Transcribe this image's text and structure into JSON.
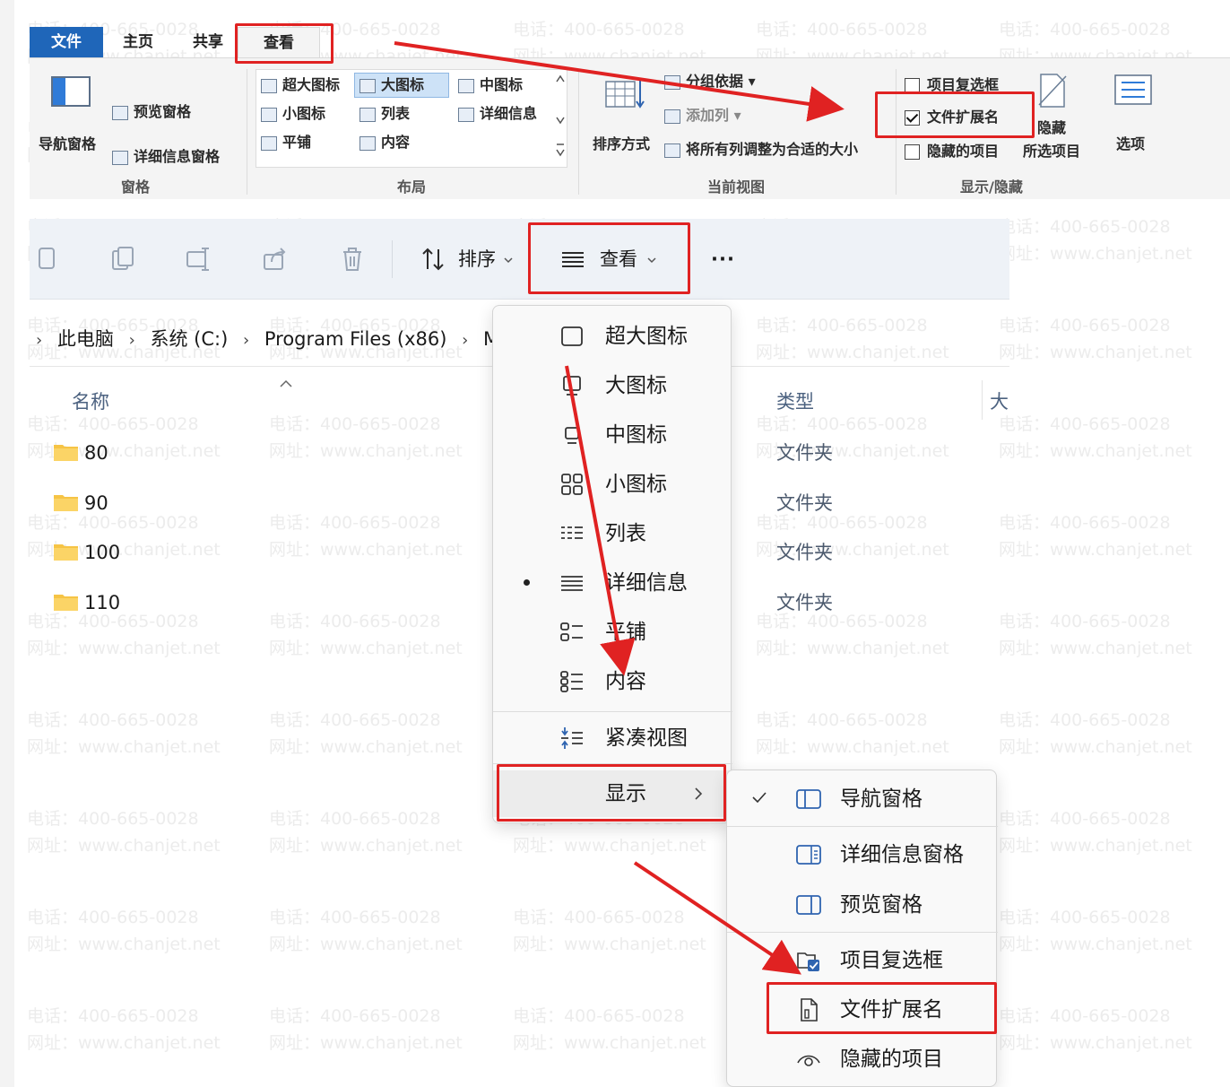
{
  "watermark": {
    "phone": "电话：400-665-0028",
    "site": "网址：www.chanjet.net"
  },
  "ribbon": {
    "tabs": {
      "file": "文件",
      "home": "主页",
      "share": "共享",
      "view": "查看"
    },
    "groups": {
      "panes": {
        "label": "窗格",
        "nav_pane": "导航窗格",
        "preview_pane": "预览窗格",
        "details_pane": "详细信息窗格"
      },
      "layout": {
        "label": "布局",
        "extra_large": "超大图标",
        "large": "大图标",
        "medium": "中图标",
        "small": "小图标",
        "list": "列表",
        "details": "详细信息",
        "tiles": "平铺",
        "content": "内容"
      },
      "current_view": {
        "label": "当前视图",
        "sort_by": "排序方式",
        "group_by": "分组依据",
        "add_column": "添加列",
        "fit_columns": "将所有列调整为合适的大小"
      },
      "show_hide": {
        "label": "显示/隐藏",
        "item_checkboxes": "项目复选框",
        "file_ext": "文件扩展名",
        "hidden_items": "隐藏的项目",
        "hide_selected": "隐藏",
        "selected_items": "所选项目",
        "options": "选项",
        "file_ext_checked": true
      }
    }
  },
  "cmdbar": {
    "sort_label": "排序",
    "view_label": "查看",
    "more": "···"
  },
  "breadcrumb": [
    "此电脑",
    "系统 (C:)",
    "Program Files (x86)",
    "Mic"
  ],
  "columns": {
    "name": "名称",
    "type": "类型",
    "size": "大"
  },
  "files": [
    {
      "name": "80",
      "type": "文件夹"
    },
    {
      "name": "90",
      "type": "文件夹"
    },
    {
      "name": "100",
      "type": "文件夹"
    },
    {
      "name": "110",
      "type": "文件夹"
    }
  ],
  "view_menu": {
    "items": [
      "超大图标",
      "大图标",
      "中图标",
      "小图标",
      "列表",
      "详细信息",
      "平铺",
      "内容"
    ],
    "selected_index": 5,
    "compact": "紧凑视图",
    "show": "显示"
  },
  "show_menu": {
    "items": [
      "导航窗格",
      "详细信息窗格",
      "预览窗格",
      "项目复选框",
      "文件扩展名",
      "隐藏的项目"
    ],
    "nav_checked": true
  },
  "colors": {
    "accent": "#1f66b9",
    "highlight": "#e02222",
    "folder": "#f6c445"
  }
}
